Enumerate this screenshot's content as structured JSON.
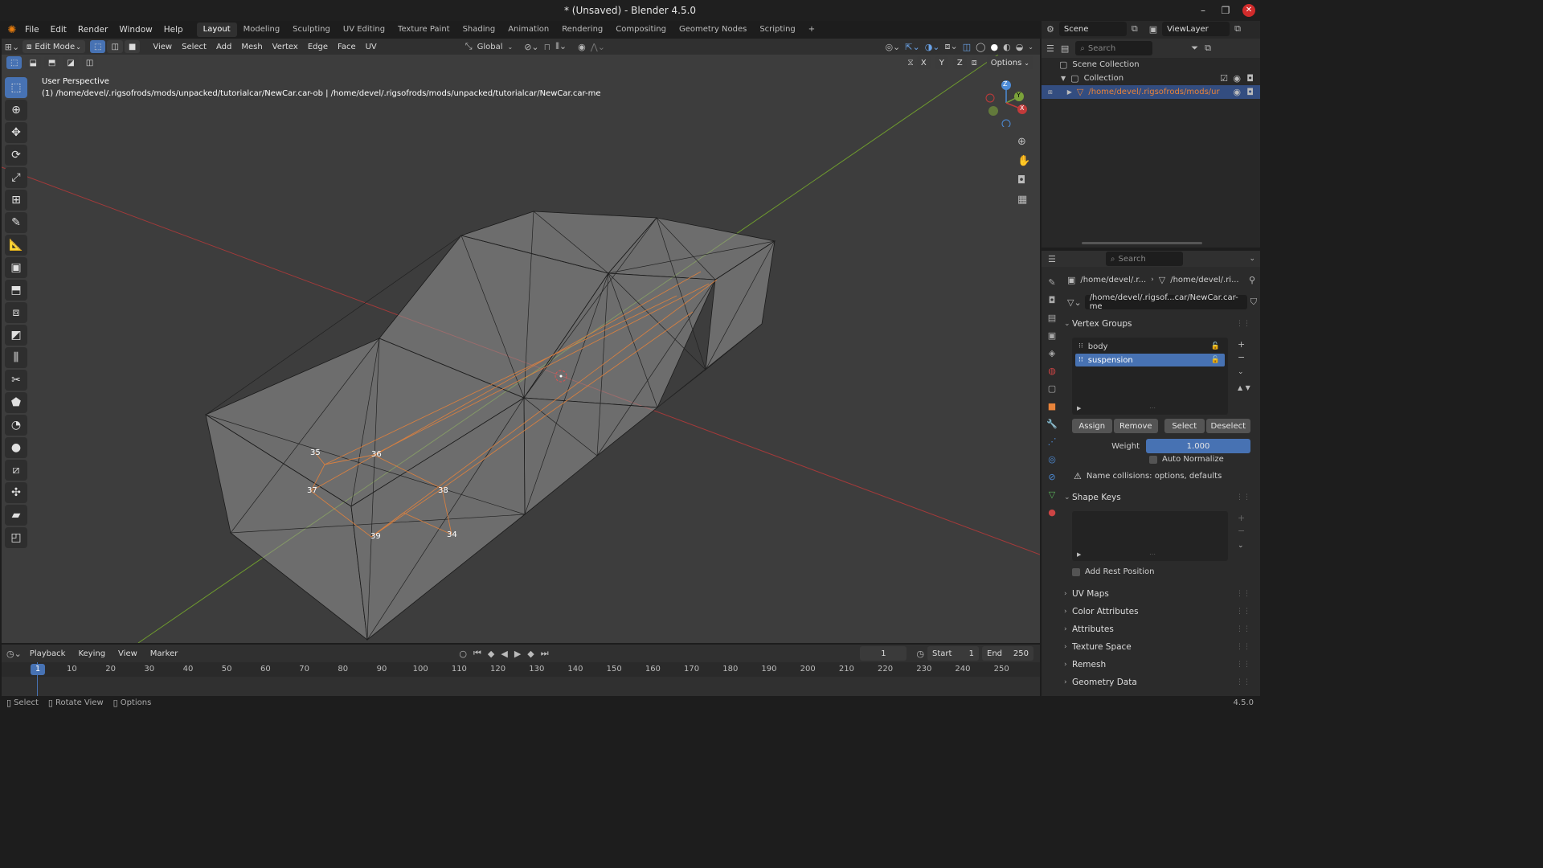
{
  "window": {
    "title": "* (Unsaved) - Blender 4.5.0",
    "controls": [
      "–",
      "❐",
      "✕"
    ]
  },
  "menubar": {
    "items": [
      "File",
      "Edit",
      "Render",
      "Window",
      "Help"
    ],
    "workspaces": [
      "Layout",
      "Modeling",
      "Sculpting",
      "UV Editing",
      "Texture Paint",
      "Shading",
      "Animation",
      "Rendering",
      "Compositing",
      "Geometry Nodes",
      "Scripting"
    ],
    "add_tab": "+",
    "scene": "Scene",
    "view_layer": "ViewLayer"
  },
  "viewport_header": {
    "mode": "Edit Mode",
    "menus": [
      "View",
      "Select",
      "Add",
      "Mesh",
      "Vertex",
      "Edge",
      "Face",
      "UV"
    ],
    "transform_orientation": "Global",
    "options": "Options",
    "axes": [
      "X",
      "Y",
      "Z"
    ]
  },
  "viewport": {
    "perspective": "User Perspective",
    "object_info": "(1) /home/devel/.rigsofrods/mods/unpacked/tutorialcar/NewCar.car-ob | /home/devel/.rigsofrods/mods/unpacked/tutorialcar/NewCar.car-me",
    "vertex_labels": [
      "35",
      "36",
      "37",
      "38",
      "39",
      "34"
    ],
    "gizmo": {
      "z": "Z",
      "y": "Y",
      "x": "X"
    }
  },
  "outliner": {
    "search_placeholder": "Search",
    "scene_collection": "Scene Collection",
    "collection": "Collection",
    "object": "/home/devel/.rigsofrods/mods/ur"
  },
  "properties": {
    "search_placeholder": "Search",
    "breadcrumb": [
      "/home/devel/.r...",
      "/home/devel/.ri..."
    ],
    "mesh_name": "/home/devel/.rigsof...car/NewCar.car-me",
    "vertex_groups": {
      "title": "Vertex Groups",
      "items": [
        {
          "name": "body",
          "selected": false
        },
        {
          "name": "suspension",
          "selected": true
        }
      ],
      "buttons": [
        "Assign",
        "Remove",
        "Select",
        "Deselect"
      ],
      "weight_label": "Weight",
      "weight_value": "1.000",
      "auto_normalize": "Auto Normalize",
      "warning": "Name collisions: options, defaults"
    },
    "shape_keys": {
      "title": "Shape Keys",
      "add_rest_position": "Add Rest Position"
    },
    "collapsed_sections": [
      "UV Maps",
      "Color Attributes",
      "Attributes",
      "Texture Space",
      "Remesh",
      "Geometry Data"
    ]
  },
  "timeline": {
    "menus": [
      "Playback",
      "Keying",
      "View",
      "Marker"
    ],
    "current_frame": "1",
    "start_label": "Start",
    "start": "1",
    "end_label": "End",
    "end": "250",
    "ruler": [
      "1",
      "10",
      "20",
      "30",
      "40",
      "50",
      "60",
      "70",
      "80",
      "90",
      "100",
      "110",
      "120",
      "130",
      "140",
      "150",
      "160",
      "170",
      "180",
      "190",
      "200",
      "210",
      "220",
      "230",
      "240",
      "250"
    ]
  },
  "statusbar": {
    "items": [
      "Select",
      "Rotate View",
      "Options"
    ],
    "version": "4.5.0"
  },
  "colors": {
    "accent": "#4772b3",
    "viewport_bg": "#3d3d3d",
    "x_axis": "#c23a3a",
    "y_axis": "#7ba23a",
    "selection": "#e8833a"
  }
}
